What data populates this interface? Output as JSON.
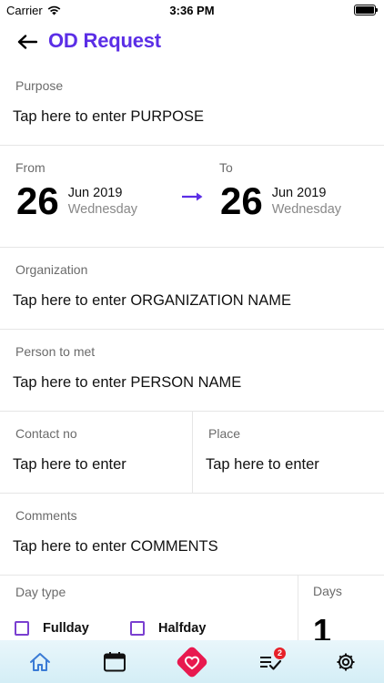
{
  "status_bar": {
    "carrier": "Carrier",
    "time": "3:36 PM"
  },
  "header": {
    "title": "OD Request"
  },
  "form": {
    "purpose": {
      "label": "Purpose",
      "value": "Tap here to enter  PURPOSE"
    },
    "from": {
      "label": "From",
      "day": "26",
      "month_year": "Jun 2019",
      "weekday": "Wednesday"
    },
    "to": {
      "label": "To",
      "day": "26",
      "month_year": "Jun 2019",
      "weekday": "Wednesday"
    },
    "organization": {
      "label": "Organization",
      "value": "Tap here to enter  ORGANIZATION NAME"
    },
    "person": {
      "label": "Person to met",
      "value": "Tap here to enter  PERSON NAME"
    },
    "contact": {
      "label": "Contact no",
      "value": "Tap here to enter"
    },
    "place": {
      "label": "Place",
      "value": "Tap here to enter"
    },
    "comments": {
      "label": "Comments",
      "value": "Tap here to enter  COMMENTS"
    },
    "day_type": {
      "label": "Day type",
      "options": [
        "Fullday",
        "Halfday"
      ]
    },
    "days": {
      "label": "Days",
      "value": "1"
    }
  },
  "tabbar": {
    "items": [
      "home-icon",
      "calendar-icon",
      "heart-icon",
      "checklist-icon",
      "gear-icon"
    ],
    "badge_count": "2"
  },
  "colors": {
    "accent": "#5b2ee6",
    "checkbox": "#7a3fd0",
    "heart_button": "#e8194f",
    "home_icon": "#3a7bd5",
    "badge": "#e62028"
  }
}
